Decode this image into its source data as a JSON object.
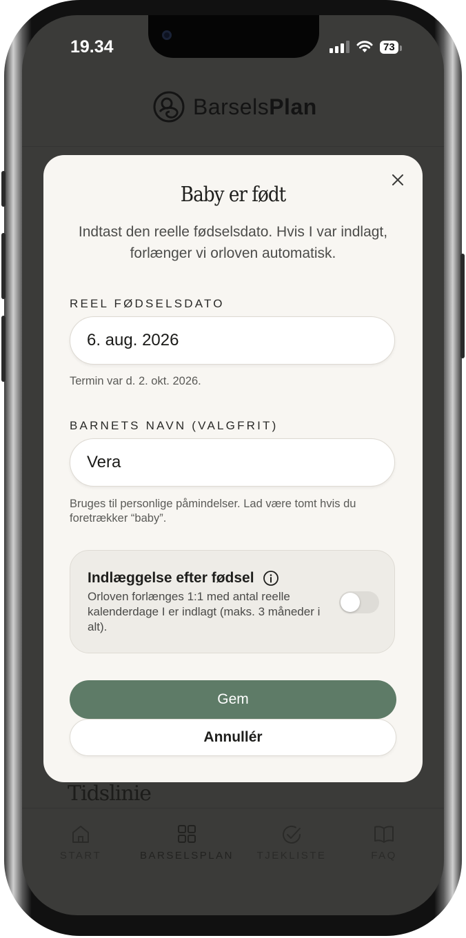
{
  "status_bar": {
    "time": "19.34",
    "battery": "73"
  },
  "header": {
    "logo_light": "Barsels",
    "logo_bold": "Plan"
  },
  "background": {
    "section_heading": "Tidslinie"
  },
  "tabbar": {
    "items": [
      {
        "label": "START",
        "icon": "home-icon"
      },
      {
        "label": "BARSELSPLAN",
        "icon": "grid-icon"
      },
      {
        "label": "TJEKLISTE",
        "icon": "check-circle-icon"
      },
      {
        "label": "FAQ",
        "icon": "book-icon"
      }
    ],
    "active": "BARSELSPLAN"
  },
  "modal": {
    "title": "Baby er født",
    "subtitle": "Indtast den reelle fødselsdato. Hvis I var indlagt, forlænger vi orloven automatisk.",
    "birthdate": {
      "label": "REEL FØDSELSDATO",
      "value": "6. aug. 2026",
      "hint": "Termin var d. 2. okt. 2026."
    },
    "child_name": {
      "label": "BARNETS NAVN (VALGFRIT)",
      "value": "Vera",
      "hint": "Bruges til personlige påmindelser. Lad være tomt hvis du foretrækker “baby”."
    },
    "hospital_toggle": {
      "title": "Indlæggelse efter fødsel",
      "description": "Orloven forlænges 1:1 med antal reelle kalenderdage I er indlagt (maks. 3 måneder i alt).",
      "checked": false
    },
    "save_label": "Gem",
    "cancel_label": "Annullér"
  },
  "colors": {
    "accent": "#5e7b67",
    "modal_bg": "#f8f6f2",
    "overlay": "#3b3b39"
  }
}
